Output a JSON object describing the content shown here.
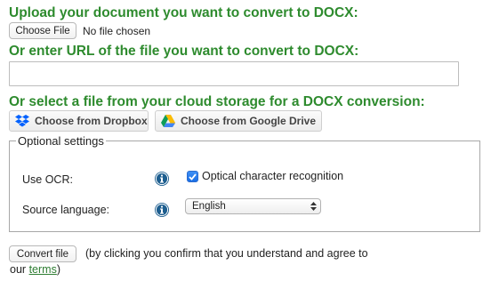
{
  "upload": {
    "heading": "Upload your document you want to convert to DOCX:",
    "choose_file_label": "Choose File",
    "file_status": "No file chosen"
  },
  "url": {
    "heading": "Or enter URL of the file you want to convert to DOCX:",
    "value": "",
    "placeholder": ""
  },
  "cloud": {
    "heading": "Or select a file from your cloud storage for a DOCX conversion:",
    "dropbox_label": "Choose from Dropbox",
    "gdrive_label": "Choose from Google Drive"
  },
  "optional": {
    "legend": "Optional settings",
    "ocr_label": "Use OCR:",
    "ocr_checkbox_label": "Optical character recognition",
    "ocr_checked": true,
    "language_label": "Source language:",
    "language_selected": "English"
  },
  "submit": {
    "button_label": "Convert file",
    "note_line1": "(by clicking you confirm that you understand and agree to",
    "note_prefix": "our",
    "terms_link": "terms",
    "note_suffix": ")"
  },
  "colors": {
    "heading_green": "#2e8b2e",
    "checkbox_blue": "#1a6fe6",
    "info_icon_blue": "#1d5e8f",
    "dropbox_blue": "#0061fe"
  }
}
